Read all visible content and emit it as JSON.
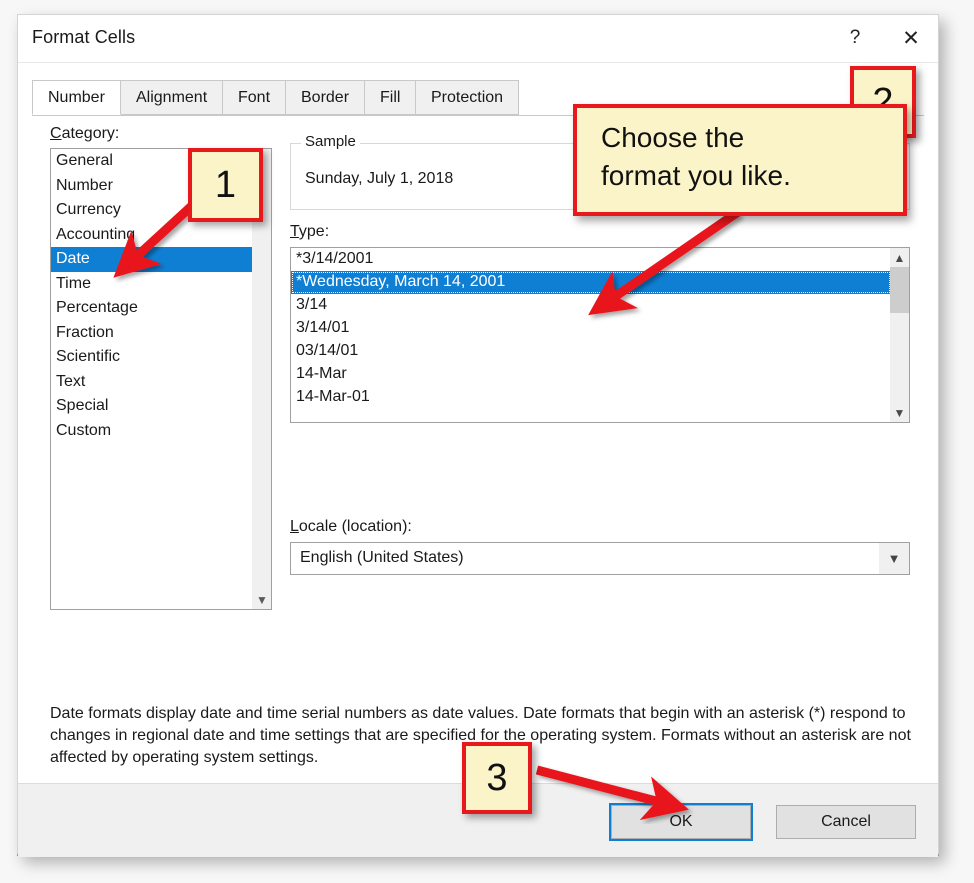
{
  "window": {
    "title": "Format Cells",
    "help_icon": "question-mark-icon",
    "close_icon": "close-x-icon",
    "accent_color": "#0f7fd4"
  },
  "tabs": [
    {
      "label": "Number",
      "active": true
    },
    {
      "label": "Alignment",
      "active": false
    },
    {
      "label": "Font",
      "active": false
    },
    {
      "label": "Border",
      "active": false
    },
    {
      "label": "Fill",
      "active": false
    },
    {
      "label": "Protection",
      "active": false
    }
  ],
  "category": {
    "label_prefix": "",
    "label_accel": "C",
    "label_rest": "ategory:",
    "items": [
      "General",
      "Number",
      "Currency",
      "Accounting",
      "Date",
      "Time",
      "Percentage",
      "Fraction",
      "Scientific",
      "Text",
      "Special",
      "Custom"
    ],
    "selected": "Date",
    "selected_index": 4,
    "scroll_down_icon": "chevron-down-icon"
  },
  "sample": {
    "legend": "Sample",
    "value": "Sunday, July 1, 2018"
  },
  "type": {
    "label_accel": "T",
    "label_rest": "ype:",
    "items": [
      "*3/14/2001",
      "*Wednesday, March 14, 2001",
      "3/14",
      "3/14/01",
      "03/14/01",
      "14-Mar",
      "14-Mar-01"
    ],
    "selected": "*Wednesday, March 14, 2001",
    "selected_index": 1,
    "scroll_up_icon": "chevron-up-icon",
    "scroll_down_icon": "chevron-down-icon"
  },
  "locale": {
    "label_accel": "L",
    "label_rest": "ocale (location):",
    "value": "English (United States)",
    "dropdown_icon": "chevron-down-icon"
  },
  "description": "Date formats display date and time serial numbers as date values.  Date formats that begin with an asterisk (*) respond to changes in regional date and time settings that are specified for the operating system. Formats without an asterisk are not affected by operating system settings.",
  "footer": {
    "ok_label": "OK",
    "cancel_label": "Cancel"
  },
  "annotations": {
    "callout_1": "1",
    "callout_2": "2",
    "callout_3": "3",
    "note_line_1": "Choose the",
    "note_line_2": "format you like.",
    "marker_color": "#e8191c",
    "note_fill": "#faf4c8"
  }
}
